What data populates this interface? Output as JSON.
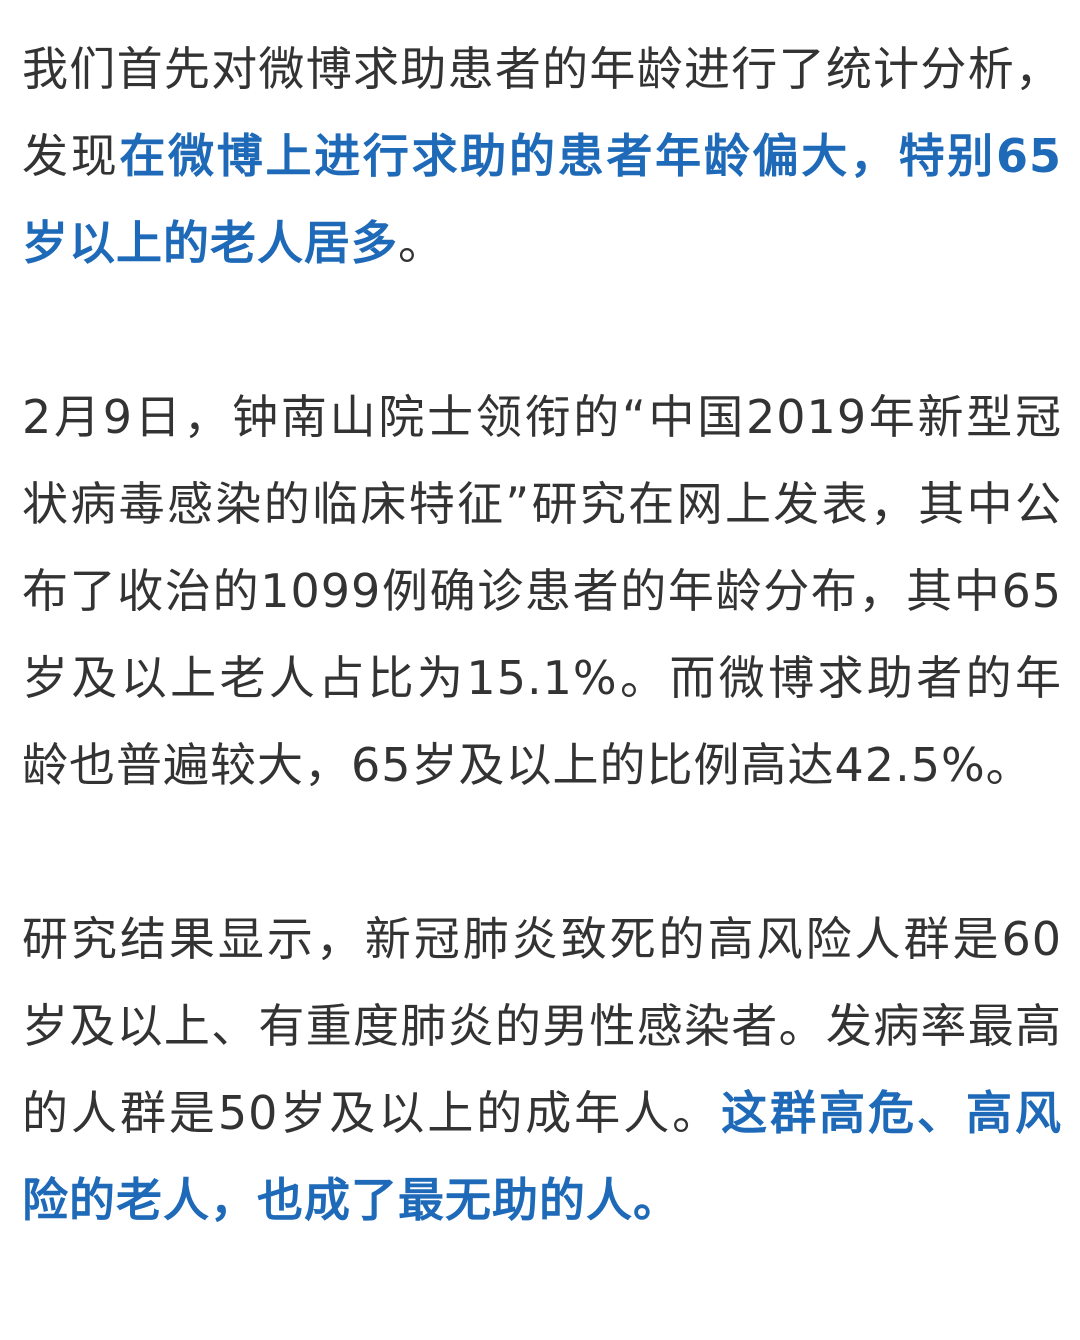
{
  "paragraphs": [
    {
      "segments": [
        {
          "text": "我们首先对微博求助患者的年龄进行了统计分析，发现",
          "highlight": false
        },
        {
          "text": "在微博上进行求助的患者年龄偏大，特别65岁以上的老人居多",
          "highlight": true
        },
        {
          "text": "。",
          "highlight": false
        }
      ]
    },
    {
      "segments": [
        {
          "text": "2月9日，钟南山院士领衔的“中国2019年新型冠状病毒感染的临床特征”研究在网上发表，其中公布了收治的1099例确诊患者的年龄分布，其中65岁及以上老人占比为15.1%。而微博求助者的年龄也普遍较大，65岁及以上的比例高达42.5%。",
          "highlight": false
        }
      ]
    },
    {
      "segments": [
        {
          "text": "研究结果显示，新冠肺炎致死的高风险人群是60岁及以上、有重度肺炎的男性感染者。发病率最高的人群是50岁及以上的成年人。",
          "highlight": false
        },
        {
          "text": "这群高危、高风险的老人，也成了最无助的人。",
          "highlight": true
        }
      ]
    }
  ],
  "colors": {
    "body_text": "#333333",
    "highlight_text": "#1e6ab8",
    "background": "#ffffff"
  }
}
